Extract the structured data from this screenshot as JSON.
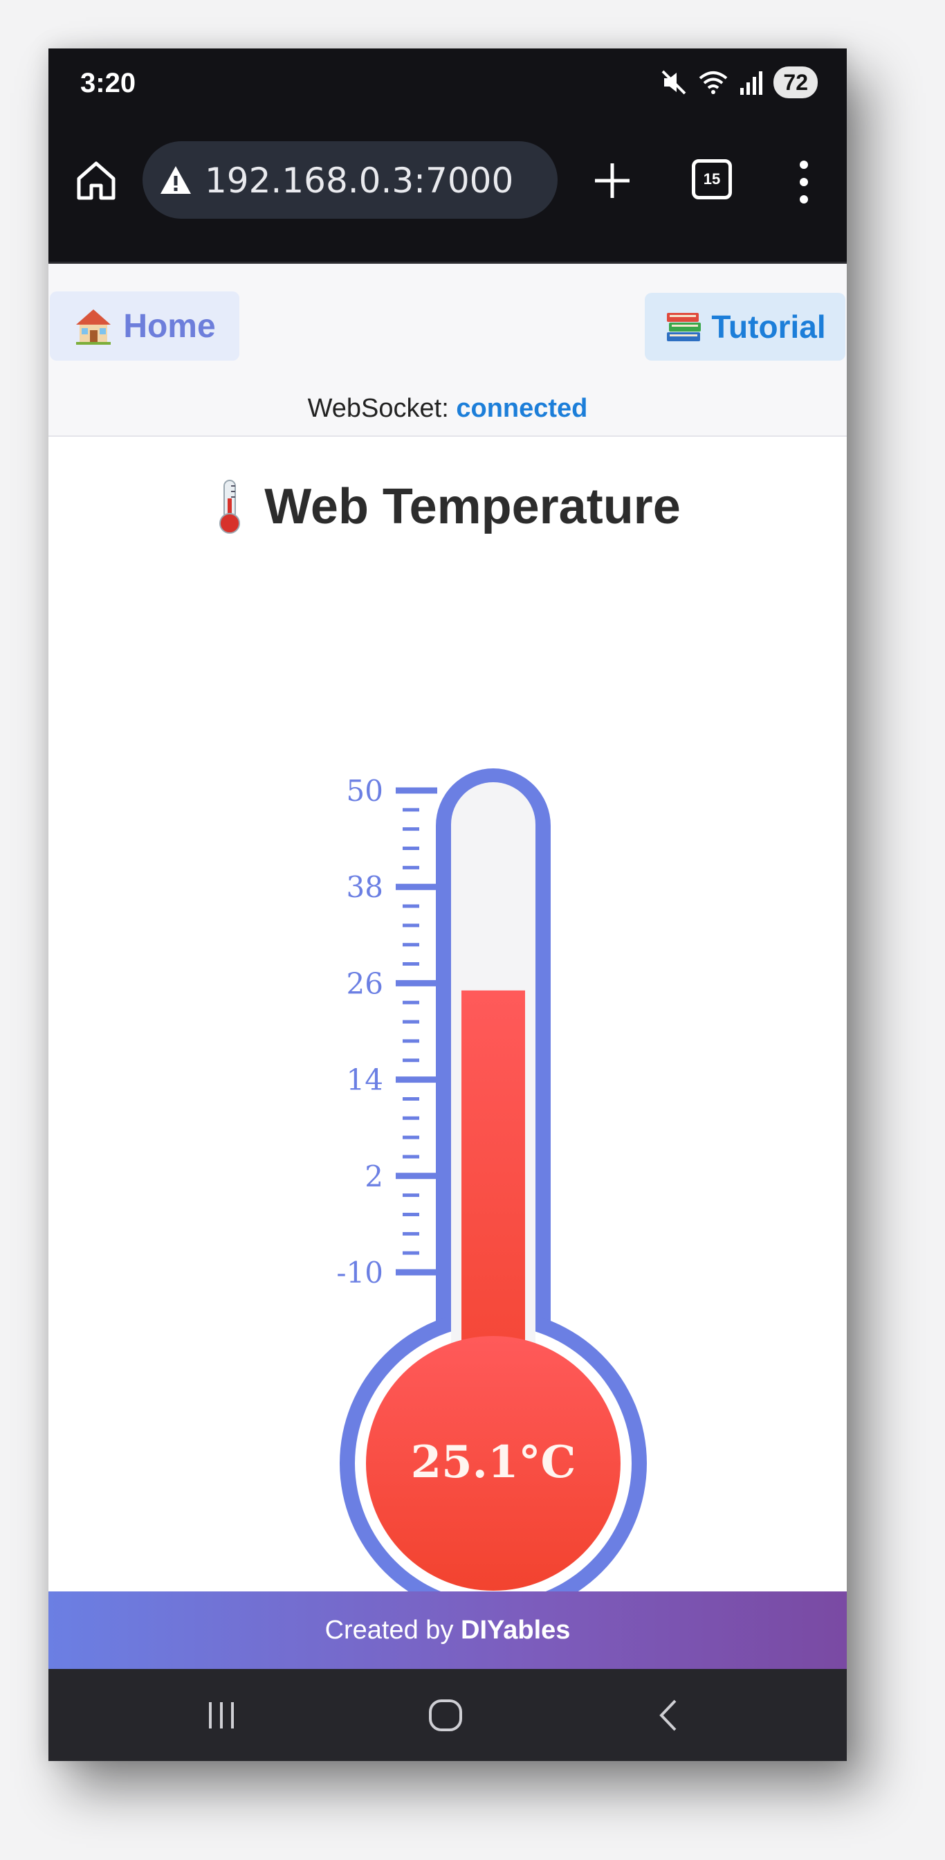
{
  "status_bar": {
    "time": "3:20",
    "battery": "72"
  },
  "browser": {
    "url": "192.168.0.3:7000",
    "tab_count": "15"
  },
  "nav": {
    "home_label": "Home",
    "tutorial_label": "Tutorial"
  },
  "websocket": {
    "label": "WebSocket:",
    "status": "connected"
  },
  "page": {
    "title": "Web Temperature"
  },
  "thermometer": {
    "value": 25.1,
    "display": "25.1°C",
    "min": -10,
    "max": 50,
    "ticks": [
      "50",
      "38",
      "26",
      "14",
      "2",
      "-10"
    ],
    "colors": {
      "frame": "#6b7fe3",
      "mercury": "#f64c4c",
      "tube": "#f4f4f6",
      "tick_text": "#6b7fe3"
    }
  },
  "footer": {
    "prefix": "Created by",
    "brand": "DIYables"
  }
}
